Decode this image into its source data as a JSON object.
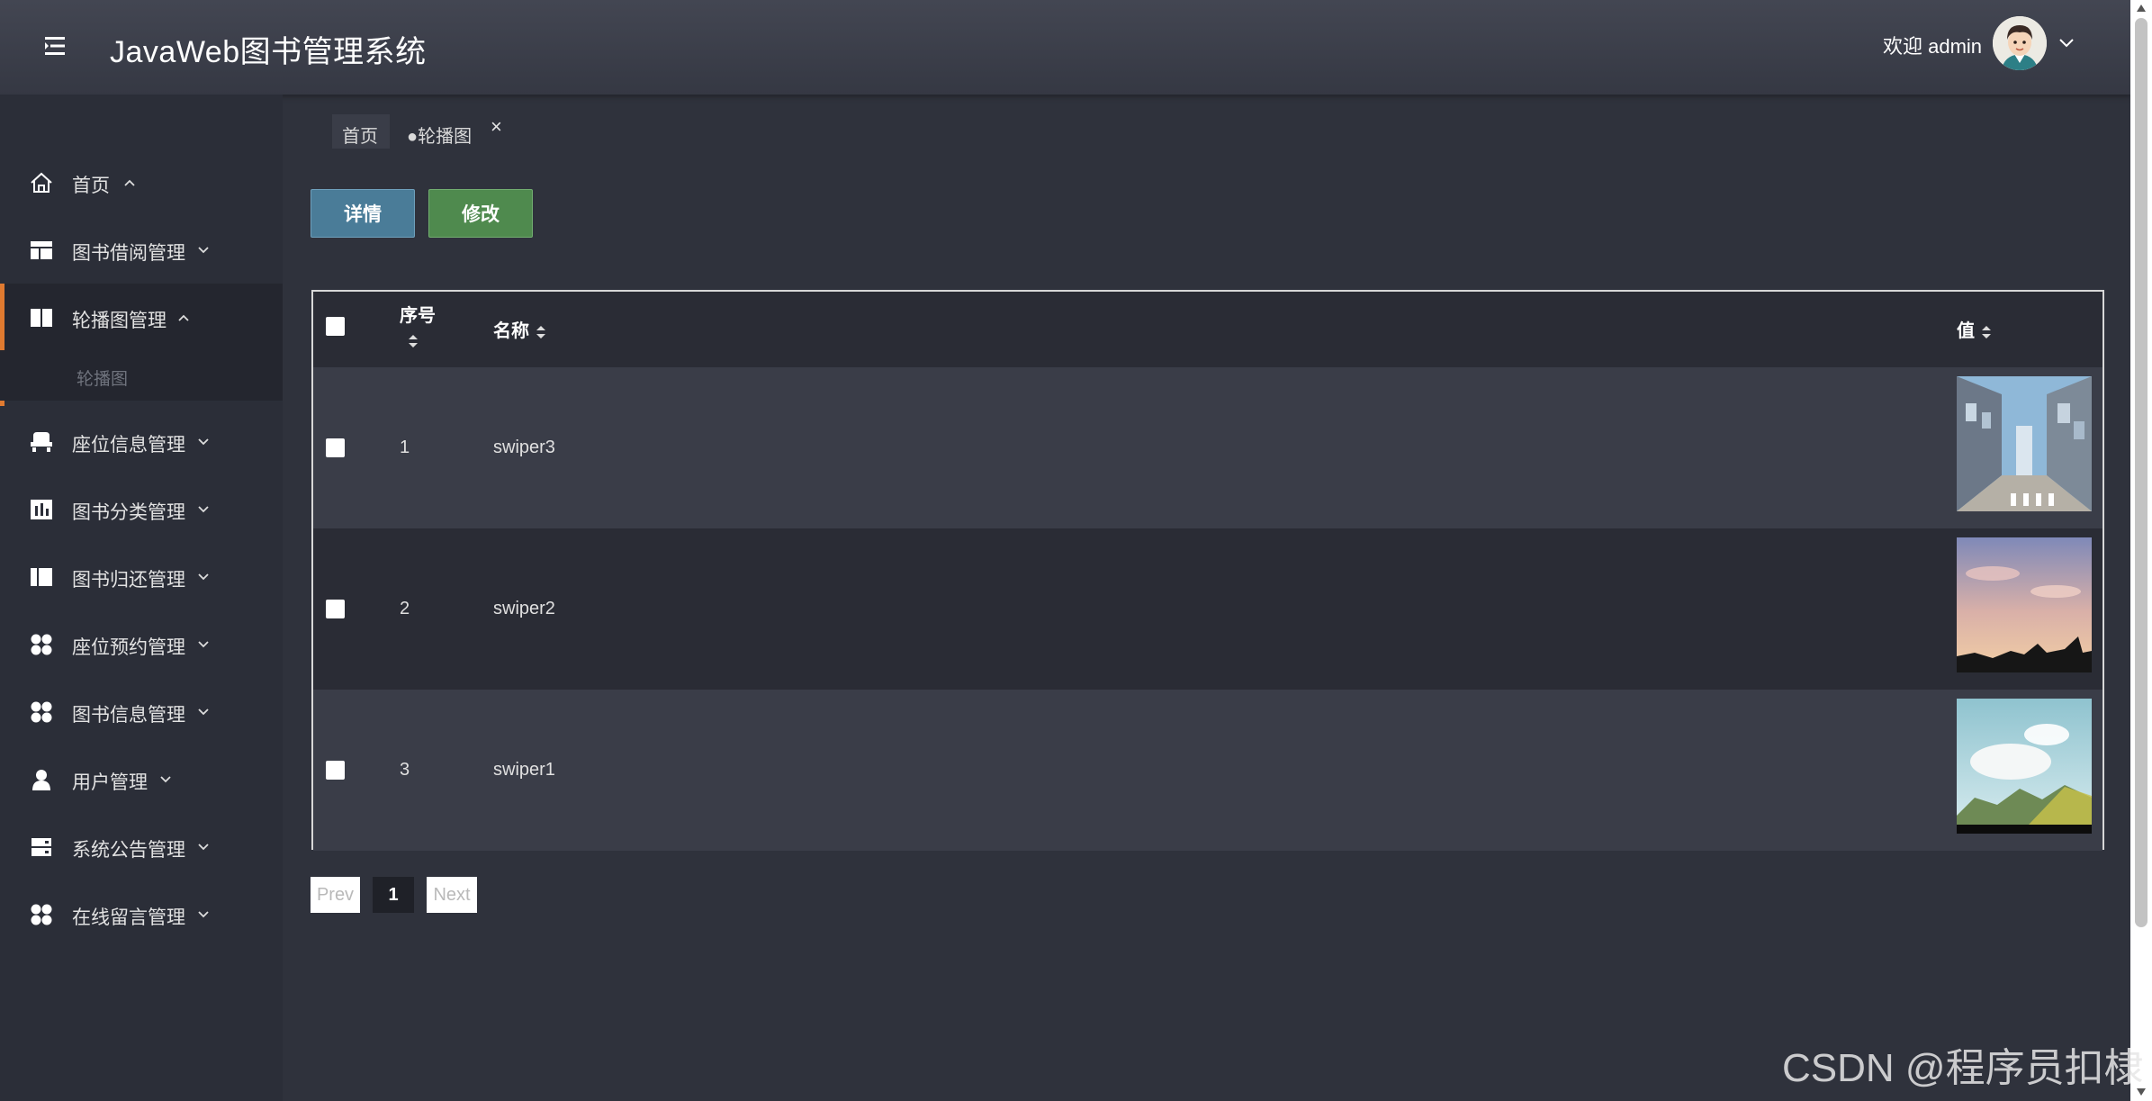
{
  "header": {
    "app_title": "JavaWeb图书管理系统",
    "welcome": "欢迎 admin"
  },
  "sidebar": {
    "items": [
      {
        "label": "首页",
        "icon": "home-icon"
      },
      {
        "label": "图书借阅管理",
        "icon": "layout-icon"
      },
      {
        "label": "轮播图管理",
        "icon": "book-icon",
        "active": true
      },
      {
        "label": "座位信息管理",
        "icon": "seat-icon"
      },
      {
        "label": "图书分类管理",
        "icon": "chart-icon"
      },
      {
        "label": "图书归还管理",
        "icon": "book-return-icon"
      },
      {
        "label": "座位预约管理",
        "icon": "grid-dots-icon"
      },
      {
        "label": "图书信息管理",
        "icon": "grid-dots-icon"
      },
      {
        "label": "用户管理",
        "icon": "user-icon"
      },
      {
        "label": "系统公告管理",
        "icon": "server-icon"
      },
      {
        "label": "在线留言管理",
        "icon": "grid-dots-icon"
      }
    ],
    "sub_item": "轮播图"
  },
  "tabs": [
    {
      "label": "首页"
    },
    {
      "label": "●轮播图"
    }
  ],
  "tab_close": "×",
  "toolbar": {
    "detail_label": "详情",
    "edit_label": "修改"
  },
  "table": {
    "headers": {
      "index": "序号",
      "name": "名称",
      "value": "值"
    },
    "rows": [
      {
        "index": "1",
        "name": "swiper3",
        "image": "city-street-image"
      },
      {
        "index": "2",
        "name": "swiper2",
        "image": "sunset-sky-image"
      },
      {
        "index": "3",
        "name": "swiper1",
        "image": "mountain-clouds-image"
      }
    ]
  },
  "pagination": {
    "prev": "Prev",
    "current": "1",
    "next": "Next"
  },
  "watermark": "CSDN @程序员扣棣",
  "colors": {
    "accent": "#e07a30",
    "detail_button": "#4a7c98",
    "edit_button": "#4f8a4e",
    "background": "#2f323c",
    "sidebar": "#2b2e38"
  }
}
